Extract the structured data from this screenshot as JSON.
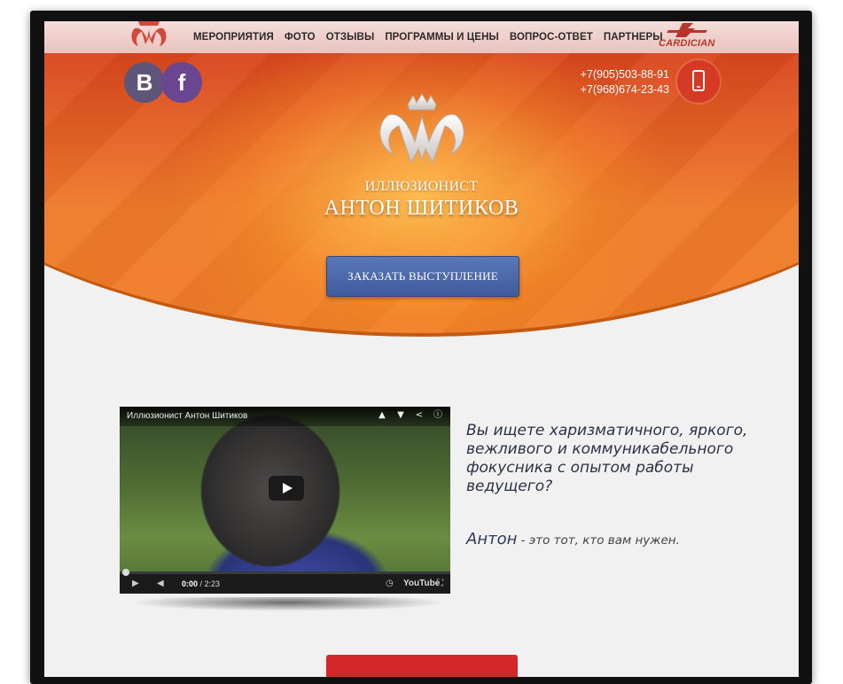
{
  "nav": {
    "items": [
      "МЕРОПРИЯТИЯ",
      "ФОТО",
      "ОТЗЫВЫ",
      "ПРОГРАММЫ И ЦЕНЫ",
      "ВОПРОС-ОТВЕТ",
      "ПАРТНЕРЫ"
    ],
    "partner": "CARDICIAN"
  },
  "hero": {
    "social": {
      "vk_glyph": "B",
      "fb_glyph": "f"
    },
    "phones": [
      "+7(905)503-88-91",
      "+7(968)674-23-43"
    ],
    "subtitle": "ИЛЛЮЗИОНИСТ",
    "name": "АНТОН ШИТИКОВ",
    "order_button": "ЗАКАЗАТЬ ВЫСТУПЛЕНИЕ"
  },
  "video": {
    "title": "Иллюзионист Антон Шитиков",
    "time_current": "0:00",
    "time_total": "/ 2:23",
    "brand": "YouTube"
  },
  "pitch": {
    "question": "Вы ищете харизматичного, яркого, вежливого и коммуникабельного фокусника с опытом работы ведущего?",
    "answer_name": "Антон",
    "answer_rest": " - это тот, кто вам нужен."
  },
  "colors": {
    "accent_orange": "#ee7a2a",
    "button_blue": "#4a67a8",
    "button_red": "#d3272a"
  }
}
